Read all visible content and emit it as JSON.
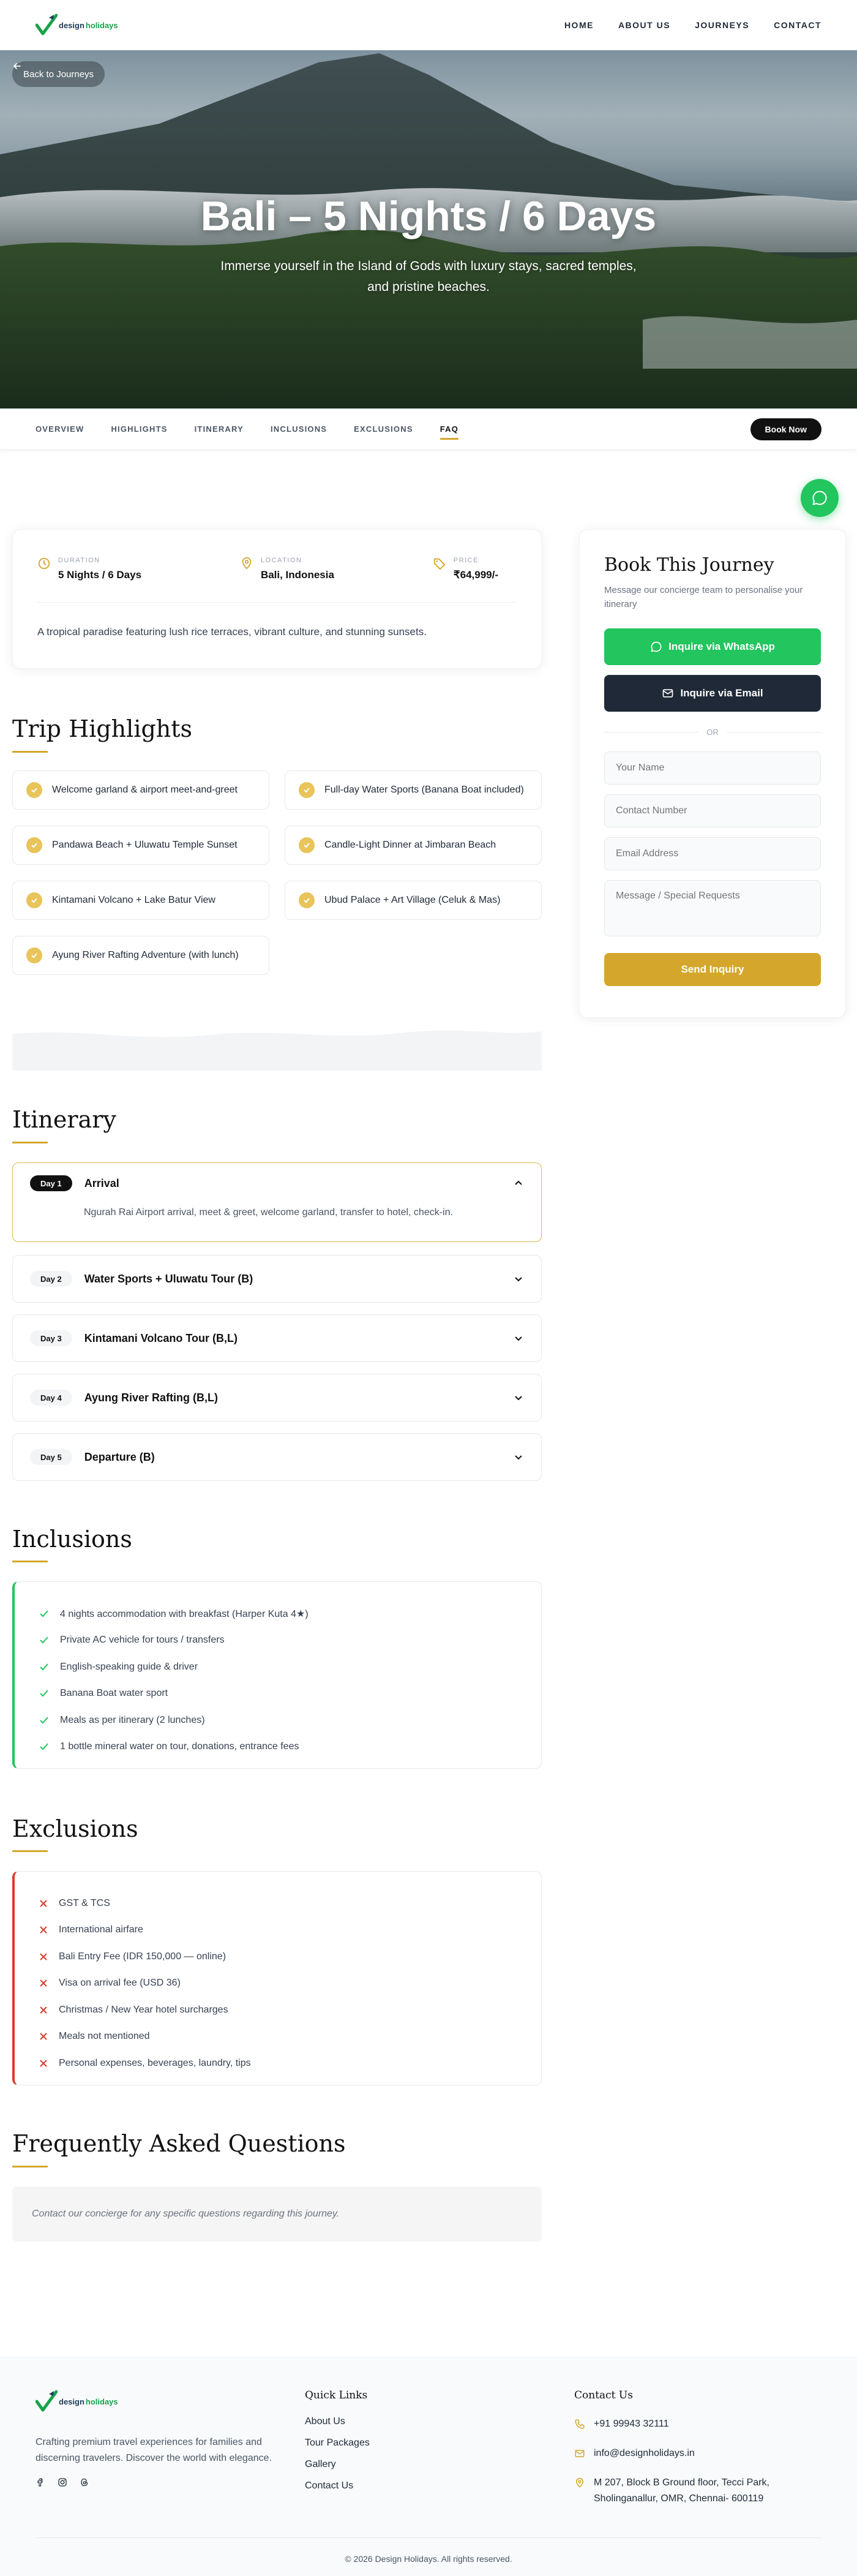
{
  "header": {
    "logo_design": "design",
    "logo_holidays": "holidays",
    "nav": [
      "HOME",
      "ABOUT US",
      "JOURNEYS",
      "CONTACT"
    ]
  },
  "hero": {
    "back_label": "Back to Journeys",
    "title": "Bali – 5 Nights / 6 Days",
    "subtitle": "Immerse yourself in the Island of Gods with luxury stays, sacred temples, and pristine beaches."
  },
  "tabs": {
    "items": [
      "OVERVIEW",
      "HIGHLIGHTS",
      "ITINERARY",
      "INCLUSIONS",
      "EXCLUSIONS",
      "FAQ"
    ],
    "active": "FAQ",
    "book_now": "Book Now"
  },
  "overview": {
    "duration_label": "DURATION",
    "duration_value": "5 Nights / 6 Days",
    "location_label": "LOCATION",
    "location_value": "Bali, Indonesia",
    "price_label": "PRICE",
    "price_value": "₹64,999/-",
    "description": "A tropical paradise featuring lush rice terraces, vibrant culture, and stunning sunsets."
  },
  "highlights": {
    "title": "Trip Highlights",
    "items": [
      "Welcome garland & airport meet-and-greet",
      "Full-day Water Sports (Banana Boat included)",
      "Pandawa Beach + Uluwatu Temple Sunset",
      "Candle-Light Dinner at Jimbaran Beach",
      "Kintamani Volcano + Lake Batur View",
      "Ubud Palace + Art Village (Celuk & Mas)",
      "Ayung River Rafting Adventure (with lunch)"
    ]
  },
  "itinerary": {
    "title": "Itinerary",
    "days": [
      {
        "badge": "Day 1",
        "title": "Arrival",
        "body": "Ngurah Rai Airport arrival, meet & greet, welcome garland, transfer to hotel, check-in."
      },
      {
        "badge": "Day 2",
        "title": "Water Sports + Uluwatu Tour (B)"
      },
      {
        "badge": "Day 3",
        "title": "Kintamani Volcano Tour (B,L)"
      },
      {
        "badge": "Day 4",
        "title": "Ayung River Rafting (B,L)"
      },
      {
        "badge": "Day 5",
        "title": "Departure (B)"
      }
    ]
  },
  "inclusions": {
    "title": "Inclusions",
    "items": [
      "4 nights accommodation with breakfast (Harper Kuta 4★)",
      "Private AC vehicle for tours / transfers",
      "English-speaking guide & driver",
      "Banana Boat water sport",
      "Meals as per itinerary (2 lunches)",
      "1 bottle mineral water on tour, donations, entrance fees"
    ]
  },
  "exclusions": {
    "title": "Exclusions",
    "items": [
      "GST & TCS",
      "International airfare",
      "Bali Entry Fee (IDR 150,000 — online)",
      "Visa on arrival fee (USD 36)",
      "Christmas / New Year hotel surcharges",
      "Meals not mentioned",
      "Personal expenses, beverages, laundry, tips"
    ]
  },
  "faq": {
    "title": "Frequently Asked Questions",
    "note": "Contact our concierge for any specific questions regarding this journey."
  },
  "booking": {
    "title": "Book This Journey",
    "subtitle": "Message our concierge team to personalise your itinerary",
    "whatsapp_label": "Inquire via WhatsApp",
    "email_label": "Inquire via Email",
    "or_label": "OR",
    "name_placeholder": "Your Name",
    "contact_placeholder": "Contact Number",
    "email_placeholder": "Email Address",
    "message_placeholder": "Message / Special Requests",
    "send_label": "Send Inquiry"
  },
  "footer": {
    "description": "Crafting premium travel experiences for families and discerning travelers. Discover the world with elegance.",
    "quick_links_title": "Quick Links",
    "quick_links": [
      "About Us",
      "Tour Packages",
      "Gallery",
      "Contact Us"
    ],
    "contact_title": "Contact Us",
    "phone": "+91 99943 32111",
    "email": "info@designholidays.in",
    "address": "M 207, Block B Ground floor, Tecci Park, Sholinganallur, OMR, Chennai- 600119",
    "copyright": "© 2026 Design Holidays. All rights reserved."
  },
  "colors": {
    "accent_gold": "#d4a72c",
    "whatsapp_green": "#22c55e",
    "exclusion_red": "#dc3c2e",
    "dark": "#111111"
  }
}
